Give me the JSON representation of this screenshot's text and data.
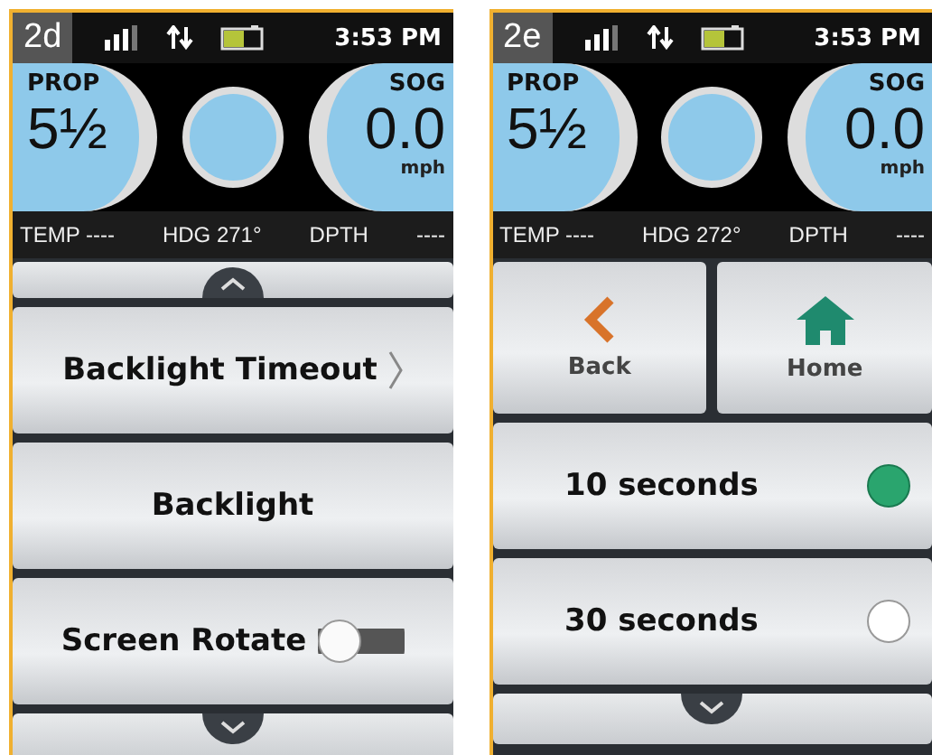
{
  "panels": [
    {
      "badge": "2d",
      "time": "3:53 PM",
      "prop": {
        "label": "PROP",
        "value": "5½"
      },
      "sog": {
        "label": "SOG",
        "value": "0.0",
        "unit": "mph"
      },
      "info": [
        "TEMP ----",
        "HDG 271°",
        "DPTH",
        "----"
      ],
      "items": [
        {
          "kind": "scroll_up"
        },
        {
          "kind": "nav",
          "label": "Backlight Timeout"
        },
        {
          "kind": "plain",
          "label": "Backlight"
        },
        {
          "kind": "toggle",
          "label": "Screen Rotate",
          "on": false
        },
        {
          "kind": "scroll_down"
        }
      ]
    },
    {
      "badge": "2e",
      "time": "3:53 PM",
      "prop": {
        "label": "PROP",
        "value": "5½"
      },
      "sog": {
        "label": "SOG",
        "value": "0.0",
        "unit": "mph"
      },
      "info": [
        "TEMP ----",
        "HDG 272°",
        "DPTH",
        "----"
      ],
      "items": [
        {
          "kind": "buttons",
          "back": "Back",
          "home": "Home"
        },
        {
          "kind": "radio",
          "label": "10 seconds",
          "selected": true
        },
        {
          "kind": "radio",
          "label": "30 seconds",
          "selected": false
        },
        {
          "kind": "scroll_down"
        }
      ]
    }
  ]
}
